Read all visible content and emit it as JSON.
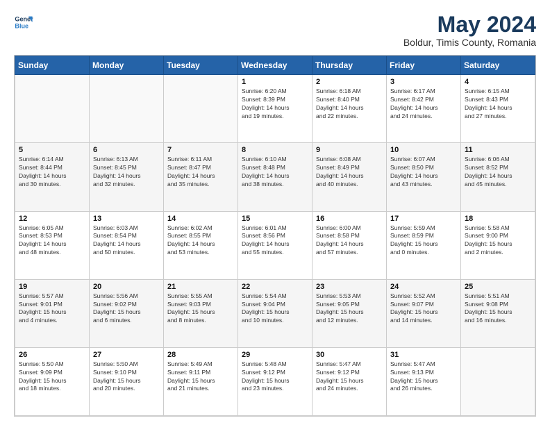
{
  "header": {
    "logo_line1": "General",
    "logo_line2": "Blue",
    "title": "May 2024",
    "subtitle": "Boldur, Timis County, Romania"
  },
  "weekdays": [
    "Sunday",
    "Monday",
    "Tuesday",
    "Wednesday",
    "Thursday",
    "Friday",
    "Saturday"
  ],
  "weeks": [
    [
      {
        "day": "",
        "info": ""
      },
      {
        "day": "",
        "info": ""
      },
      {
        "day": "",
        "info": ""
      },
      {
        "day": "1",
        "info": "Sunrise: 6:20 AM\nSunset: 8:39 PM\nDaylight: 14 hours\nand 19 minutes."
      },
      {
        "day": "2",
        "info": "Sunrise: 6:18 AM\nSunset: 8:40 PM\nDaylight: 14 hours\nand 22 minutes."
      },
      {
        "day": "3",
        "info": "Sunrise: 6:17 AM\nSunset: 8:42 PM\nDaylight: 14 hours\nand 24 minutes."
      },
      {
        "day": "4",
        "info": "Sunrise: 6:15 AM\nSunset: 8:43 PM\nDaylight: 14 hours\nand 27 minutes."
      }
    ],
    [
      {
        "day": "5",
        "info": "Sunrise: 6:14 AM\nSunset: 8:44 PM\nDaylight: 14 hours\nand 30 minutes."
      },
      {
        "day": "6",
        "info": "Sunrise: 6:13 AM\nSunset: 8:45 PM\nDaylight: 14 hours\nand 32 minutes."
      },
      {
        "day": "7",
        "info": "Sunrise: 6:11 AM\nSunset: 8:47 PM\nDaylight: 14 hours\nand 35 minutes."
      },
      {
        "day": "8",
        "info": "Sunrise: 6:10 AM\nSunset: 8:48 PM\nDaylight: 14 hours\nand 38 minutes."
      },
      {
        "day": "9",
        "info": "Sunrise: 6:08 AM\nSunset: 8:49 PM\nDaylight: 14 hours\nand 40 minutes."
      },
      {
        "day": "10",
        "info": "Sunrise: 6:07 AM\nSunset: 8:50 PM\nDaylight: 14 hours\nand 43 minutes."
      },
      {
        "day": "11",
        "info": "Sunrise: 6:06 AM\nSunset: 8:52 PM\nDaylight: 14 hours\nand 45 minutes."
      }
    ],
    [
      {
        "day": "12",
        "info": "Sunrise: 6:05 AM\nSunset: 8:53 PM\nDaylight: 14 hours\nand 48 minutes."
      },
      {
        "day": "13",
        "info": "Sunrise: 6:03 AM\nSunset: 8:54 PM\nDaylight: 14 hours\nand 50 minutes."
      },
      {
        "day": "14",
        "info": "Sunrise: 6:02 AM\nSunset: 8:55 PM\nDaylight: 14 hours\nand 53 minutes."
      },
      {
        "day": "15",
        "info": "Sunrise: 6:01 AM\nSunset: 8:56 PM\nDaylight: 14 hours\nand 55 minutes."
      },
      {
        "day": "16",
        "info": "Sunrise: 6:00 AM\nSunset: 8:58 PM\nDaylight: 14 hours\nand 57 minutes."
      },
      {
        "day": "17",
        "info": "Sunrise: 5:59 AM\nSunset: 8:59 PM\nDaylight: 15 hours\nand 0 minutes."
      },
      {
        "day": "18",
        "info": "Sunrise: 5:58 AM\nSunset: 9:00 PM\nDaylight: 15 hours\nand 2 minutes."
      }
    ],
    [
      {
        "day": "19",
        "info": "Sunrise: 5:57 AM\nSunset: 9:01 PM\nDaylight: 15 hours\nand 4 minutes."
      },
      {
        "day": "20",
        "info": "Sunrise: 5:56 AM\nSunset: 9:02 PM\nDaylight: 15 hours\nand 6 minutes."
      },
      {
        "day": "21",
        "info": "Sunrise: 5:55 AM\nSunset: 9:03 PM\nDaylight: 15 hours\nand 8 minutes."
      },
      {
        "day": "22",
        "info": "Sunrise: 5:54 AM\nSunset: 9:04 PM\nDaylight: 15 hours\nand 10 minutes."
      },
      {
        "day": "23",
        "info": "Sunrise: 5:53 AM\nSunset: 9:05 PM\nDaylight: 15 hours\nand 12 minutes."
      },
      {
        "day": "24",
        "info": "Sunrise: 5:52 AM\nSunset: 9:07 PM\nDaylight: 15 hours\nand 14 minutes."
      },
      {
        "day": "25",
        "info": "Sunrise: 5:51 AM\nSunset: 9:08 PM\nDaylight: 15 hours\nand 16 minutes."
      }
    ],
    [
      {
        "day": "26",
        "info": "Sunrise: 5:50 AM\nSunset: 9:09 PM\nDaylight: 15 hours\nand 18 minutes."
      },
      {
        "day": "27",
        "info": "Sunrise: 5:50 AM\nSunset: 9:10 PM\nDaylight: 15 hours\nand 20 minutes."
      },
      {
        "day": "28",
        "info": "Sunrise: 5:49 AM\nSunset: 9:11 PM\nDaylight: 15 hours\nand 21 minutes."
      },
      {
        "day": "29",
        "info": "Sunrise: 5:48 AM\nSunset: 9:12 PM\nDaylight: 15 hours\nand 23 minutes."
      },
      {
        "day": "30",
        "info": "Sunrise: 5:47 AM\nSunset: 9:12 PM\nDaylight: 15 hours\nand 24 minutes."
      },
      {
        "day": "31",
        "info": "Sunrise: 5:47 AM\nSunset: 9:13 PM\nDaylight: 15 hours\nand 26 minutes."
      },
      {
        "day": "",
        "info": ""
      }
    ]
  ]
}
